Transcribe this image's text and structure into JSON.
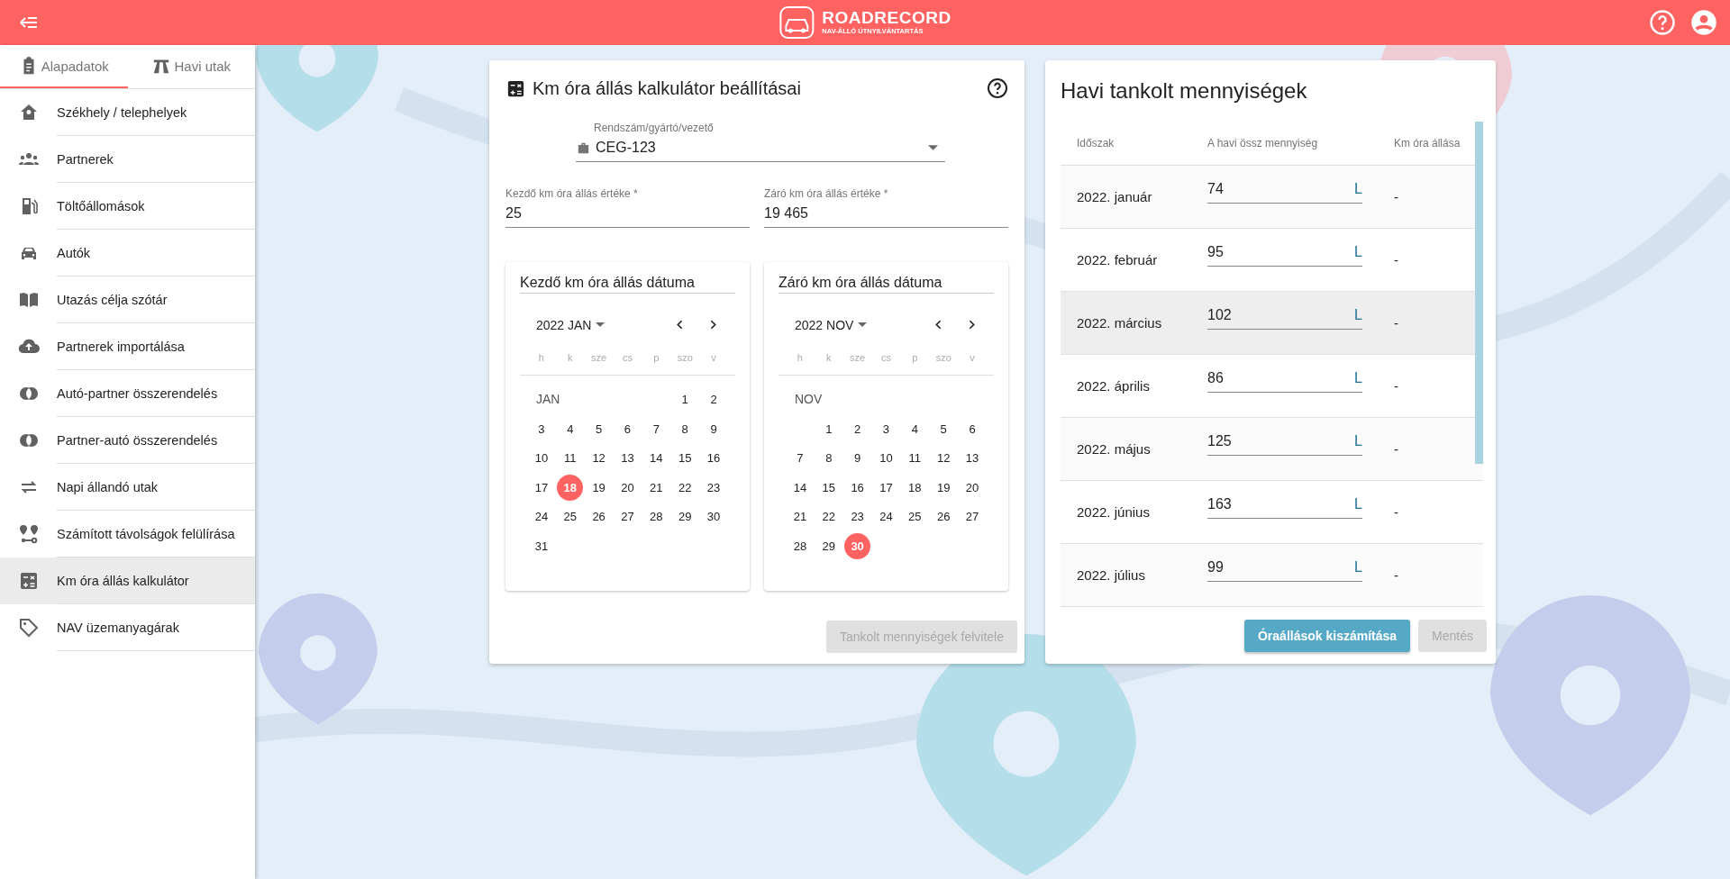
{
  "header": {
    "brand": "ROADRECORD",
    "tagline": "NAV-ÁLLÓ ÚTNYILVÁNTARTÁS"
  },
  "sidebar": {
    "tabs": [
      {
        "label": "Alapadatok",
        "selected": true,
        "kind": "clipboard"
      },
      {
        "label": "Havi utak",
        "selected": false,
        "kind": "road"
      }
    ],
    "items": [
      {
        "label": "Székhely / telephelyek",
        "kind": "home",
        "selected": false
      },
      {
        "label": "Partnerek",
        "kind": "people",
        "selected": false
      },
      {
        "label": "Töltőállomások",
        "kind": "fuel",
        "selected": false
      },
      {
        "label": "Autók",
        "kind": "car",
        "selected": false
      },
      {
        "label": "Utazás célja szótár",
        "kind": "book",
        "selected": false
      },
      {
        "label": "Partnerek importálása",
        "kind": "upload",
        "selected": false
      },
      {
        "label": "Autó-partner összerendelés",
        "kind": "link",
        "selected": false
      },
      {
        "label": "Partner-autó összerendelés",
        "kind": "link",
        "selected": false
      },
      {
        "label": "Napi állandó utak",
        "kind": "repeat",
        "selected": false
      },
      {
        "label": "Számított távolságok felülírása",
        "kind": "route",
        "selected": false
      },
      {
        "label": "Km óra állás kalkulátor",
        "kind": "calc",
        "selected": true
      },
      {
        "label": "NAV üzemanyagárak",
        "kind": "tag",
        "selected": false
      }
    ]
  },
  "settings": {
    "title": "Km óra állás kalkulátor beállításai",
    "vehicle": {
      "label": "Rendszám/gyártó/vezető",
      "value": "CEG-123"
    },
    "start_value": {
      "label": "Kezdő km óra állás értéke *",
      "value": "25"
    },
    "end_value": {
      "label": "Záró km óra állás értéke *",
      "value": "19 465"
    },
    "calendars": [
      {
        "title": "Kezdő km óra állás dátuma",
        "month": "2022 JAN",
        "month_label": "JAN",
        "weekdays": [
          "h",
          "k",
          "sze",
          "cs",
          "p",
          "szo",
          "v"
        ],
        "weeks": [
          {
            "days": [
              {
                "day": "1",
                "selected": false
              },
              {
                "day": "2",
                "selected": false
              }
            ]
          },
          {
            "days": [
              {
                "day": "3",
                "selected": false
              },
              {
                "day": "4",
                "selected": false
              },
              {
                "day": "5",
                "selected": false
              },
              {
                "day": "6",
                "selected": false
              },
              {
                "day": "7",
                "selected": false
              },
              {
                "day": "8",
                "selected": false
              },
              {
                "day": "9",
                "selected": false
              }
            ]
          },
          {
            "days": [
              {
                "day": "10",
                "selected": false
              },
              {
                "day": "11",
                "selected": false
              },
              {
                "day": "12",
                "selected": false
              },
              {
                "day": "13",
                "selected": false
              },
              {
                "day": "14",
                "selected": false
              },
              {
                "day": "15",
                "selected": false
              },
              {
                "day": "16",
                "selected": false
              }
            ]
          },
          {
            "days": [
              {
                "day": "17",
                "selected": false
              },
              {
                "day": "18",
                "selected": true
              },
              {
                "day": "19",
                "selected": false
              },
              {
                "day": "20",
                "selected": false
              },
              {
                "day": "21",
                "selected": false
              },
              {
                "day": "22",
                "selected": false
              },
              {
                "day": "23",
                "selected": false
              }
            ]
          },
          {
            "days": [
              {
                "day": "24",
                "selected": false
              },
              {
                "day": "25",
                "selected": false
              },
              {
                "day": "26",
                "selected": false
              },
              {
                "day": "27",
                "selected": false
              },
              {
                "day": "28",
                "selected": false
              },
              {
                "day": "29",
                "selected": false
              },
              {
                "day": "30",
                "selected": false
              }
            ]
          },
          {
            "days": [
              {
                "day": "31",
                "selected": false
              }
            ]
          }
        ]
      },
      {
        "title": "Záró km óra állás dátuma",
        "month": "2022 NOV",
        "month_label": "NOV",
        "weekdays": [
          "h",
          "k",
          "sze",
          "cs",
          "p",
          "szo",
          "v"
        ],
        "weeks": [
          {
            "days": [
              {
                "day": "1",
                "selected": false
              },
              {
                "day": "2",
                "selected": false
              },
              {
                "day": "3",
                "selected": false
              },
              {
                "day": "4",
                "selected": false
              },
              {
                "day": "5",
                "selected": false
              },
              {
                "day": "6",
                "selected": false
              }
            ]
          },
          {
            "days": [
              {
                "day": "7",
                "selected": false
              },
              {
                "day": "8",
                "selected": false
              },
              {
                "day": "9",
                "selected": false
              },
              {
                "day": "10",
                "selected": false
              },
              {
                "day": "11",
                "selected": false
              },
              {
                "day": "12",
                "selected": false
              },
              {
                "day": "13",
                "selected": false
              }
            ]
          },
          {
            "days": [
              {
                "day": "14",
                "selected": false
              },
              {
                "day": "15",
                "selected": false
              },
              {
                "day": "16",
                "selected": false
              },
              {
                "day": "17",
                "selected": false
              },
              {
                "day": "18",
                "selected": false
              },
              {
                "day": "19",
                "selected": false
              },
              {
                "day": "20",
                "selected": false
              }
            ]
          },
          {
            "days": [
              {
                "day": "21",
                "selected": false
              },
              {
                "day": "22",
                "selected": false
              },
              {
                "day": "23",
                "selected": false
              },
              {
                "day": "24",
                "selected": false
              },
              {
                "day": "25",
                "selected": false
              },
              {
                "day": "26",
                "selected": false
              },
              {
                "day": "27",
                "selected": false
              }
            ]
          },
          {
            "days": [
              {
                "day": "28",
                "selected": false
              },
              {
                "day": "29",
                "selected": false
              },
              {
                "day": "30",
                "selected": true
              }
            ]
          }
        ]
      }
    ],
    "button": {
      "label": "Tankolt mennyiségek felvitele",
      "disabled": true
    }
  },
  "monthly": {
    "title": "Havi tankolt mennyiségek",
    "columns": [
      "Időszak",
      "A havi össz mennyiség",
      "Km óra állása"
    ],
    "rows": [
      {
        "period": "2022. január",
        "amount": "74",
        "unit": "L",
        "km": "-",
        "highlighted": false
      },
      {
        "period": "2022. február",
        "amount": "95",
        "unit": "L",
        "km": "-",
        "highlighted": false
      },
      {
        "period": "2022. március",
        "amount": "102",
        "unit": "L",
        "km": "-",
        "highlighted": true
      },
      {
        "period": "2022. április",
        "amount": "86",
        "unit": "L",
        "km": "-",
        "highlighted": false
      },
      {
        "period": "2022. május",
        "amount": "125",
        "unit": "L",
        "km": "-",
        "highlighted": false
      },
      {
        "period": "2022. június",
        "amount": "163",
        "unit": "L",
        "km": "-",
        "highlighted": false
      },
      {
        "period": "2022. július",
        "amount": "99",
        "unit": "L",
        "km": "-",
        "highlighted": false
      }
    ],
    "buttons": [
      {
        "label": "Óraállások kiszámítása",
        "disabled": false
      },
      {
        "label": "Mentés",
        "disabled": true
      }
    ]
  }
}
